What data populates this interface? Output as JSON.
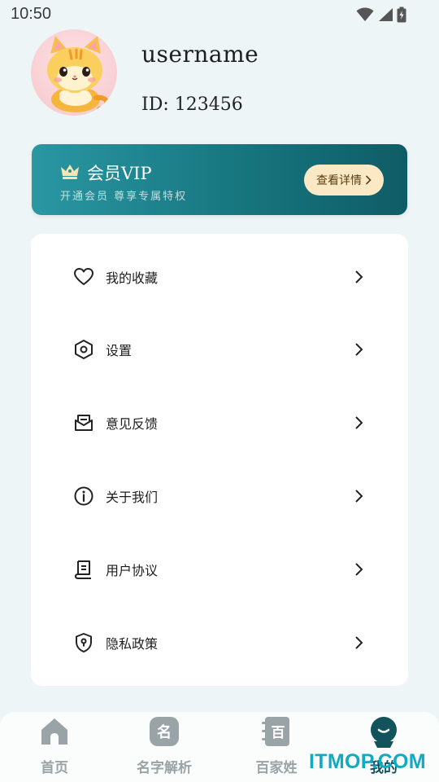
{
  "status_bar": {
    "time": "10:50"
  },
  "profile": {
    "username": "username",
    "id_text": "ID: 123456"
  },
  "vip": {
    "title": "会员VIP",
    "subtitle": "开通会员 尊享专属特权",
    "button_label": "查看详情",
    "colors": {
      "card_start": "#2a97a3",
      "card_end": "#0f5c66",
      "button_bg": "#fbe9c6",
      "crown": "#fbe4b4"
    }
  },
  "menu": {
    "items": [
      {
        "label": "我的收藏",
        "icon": "heart-icon"
      },
      {
        "label": "设置",
        "icon": "hexagon-settings-icon"
      },
      {
        "label": "意见反馈",
        "icon": "feedback-mail-icon"
      },
      {
        "label": "关于我们",
        "icon": "info-icon"
      },
      {
        "label": "用户协议",
        "icon": "document-icon"
      },
      {
        "label": "隐私政策",
        "icon": "shield-lock-icon"
      }
    ]
  },
  "bottom_nav": {
    "items": [
      {
        "label": "首页",
        "icon": "home-icon",
        "active": false
      },
      {
        "label": "名字解析",
        "icon": "name-badge-icon",
        "icon_text": "名",
        "active": false
      },
      {
        "label": "百家姓",
        "icon": "book-icon",
        "icon_text": "百",
        "active": false
      },
      {
        "label": "我的",
        "icon": "profile-face-icon",
        "active": true
      }
    ],
    "colors": {
      "inactive": "#9aa3a6",
      "active": "#12535c"
    }
  },
  "watermark": {
    "text": "ITMOP.COM"
  }
}
